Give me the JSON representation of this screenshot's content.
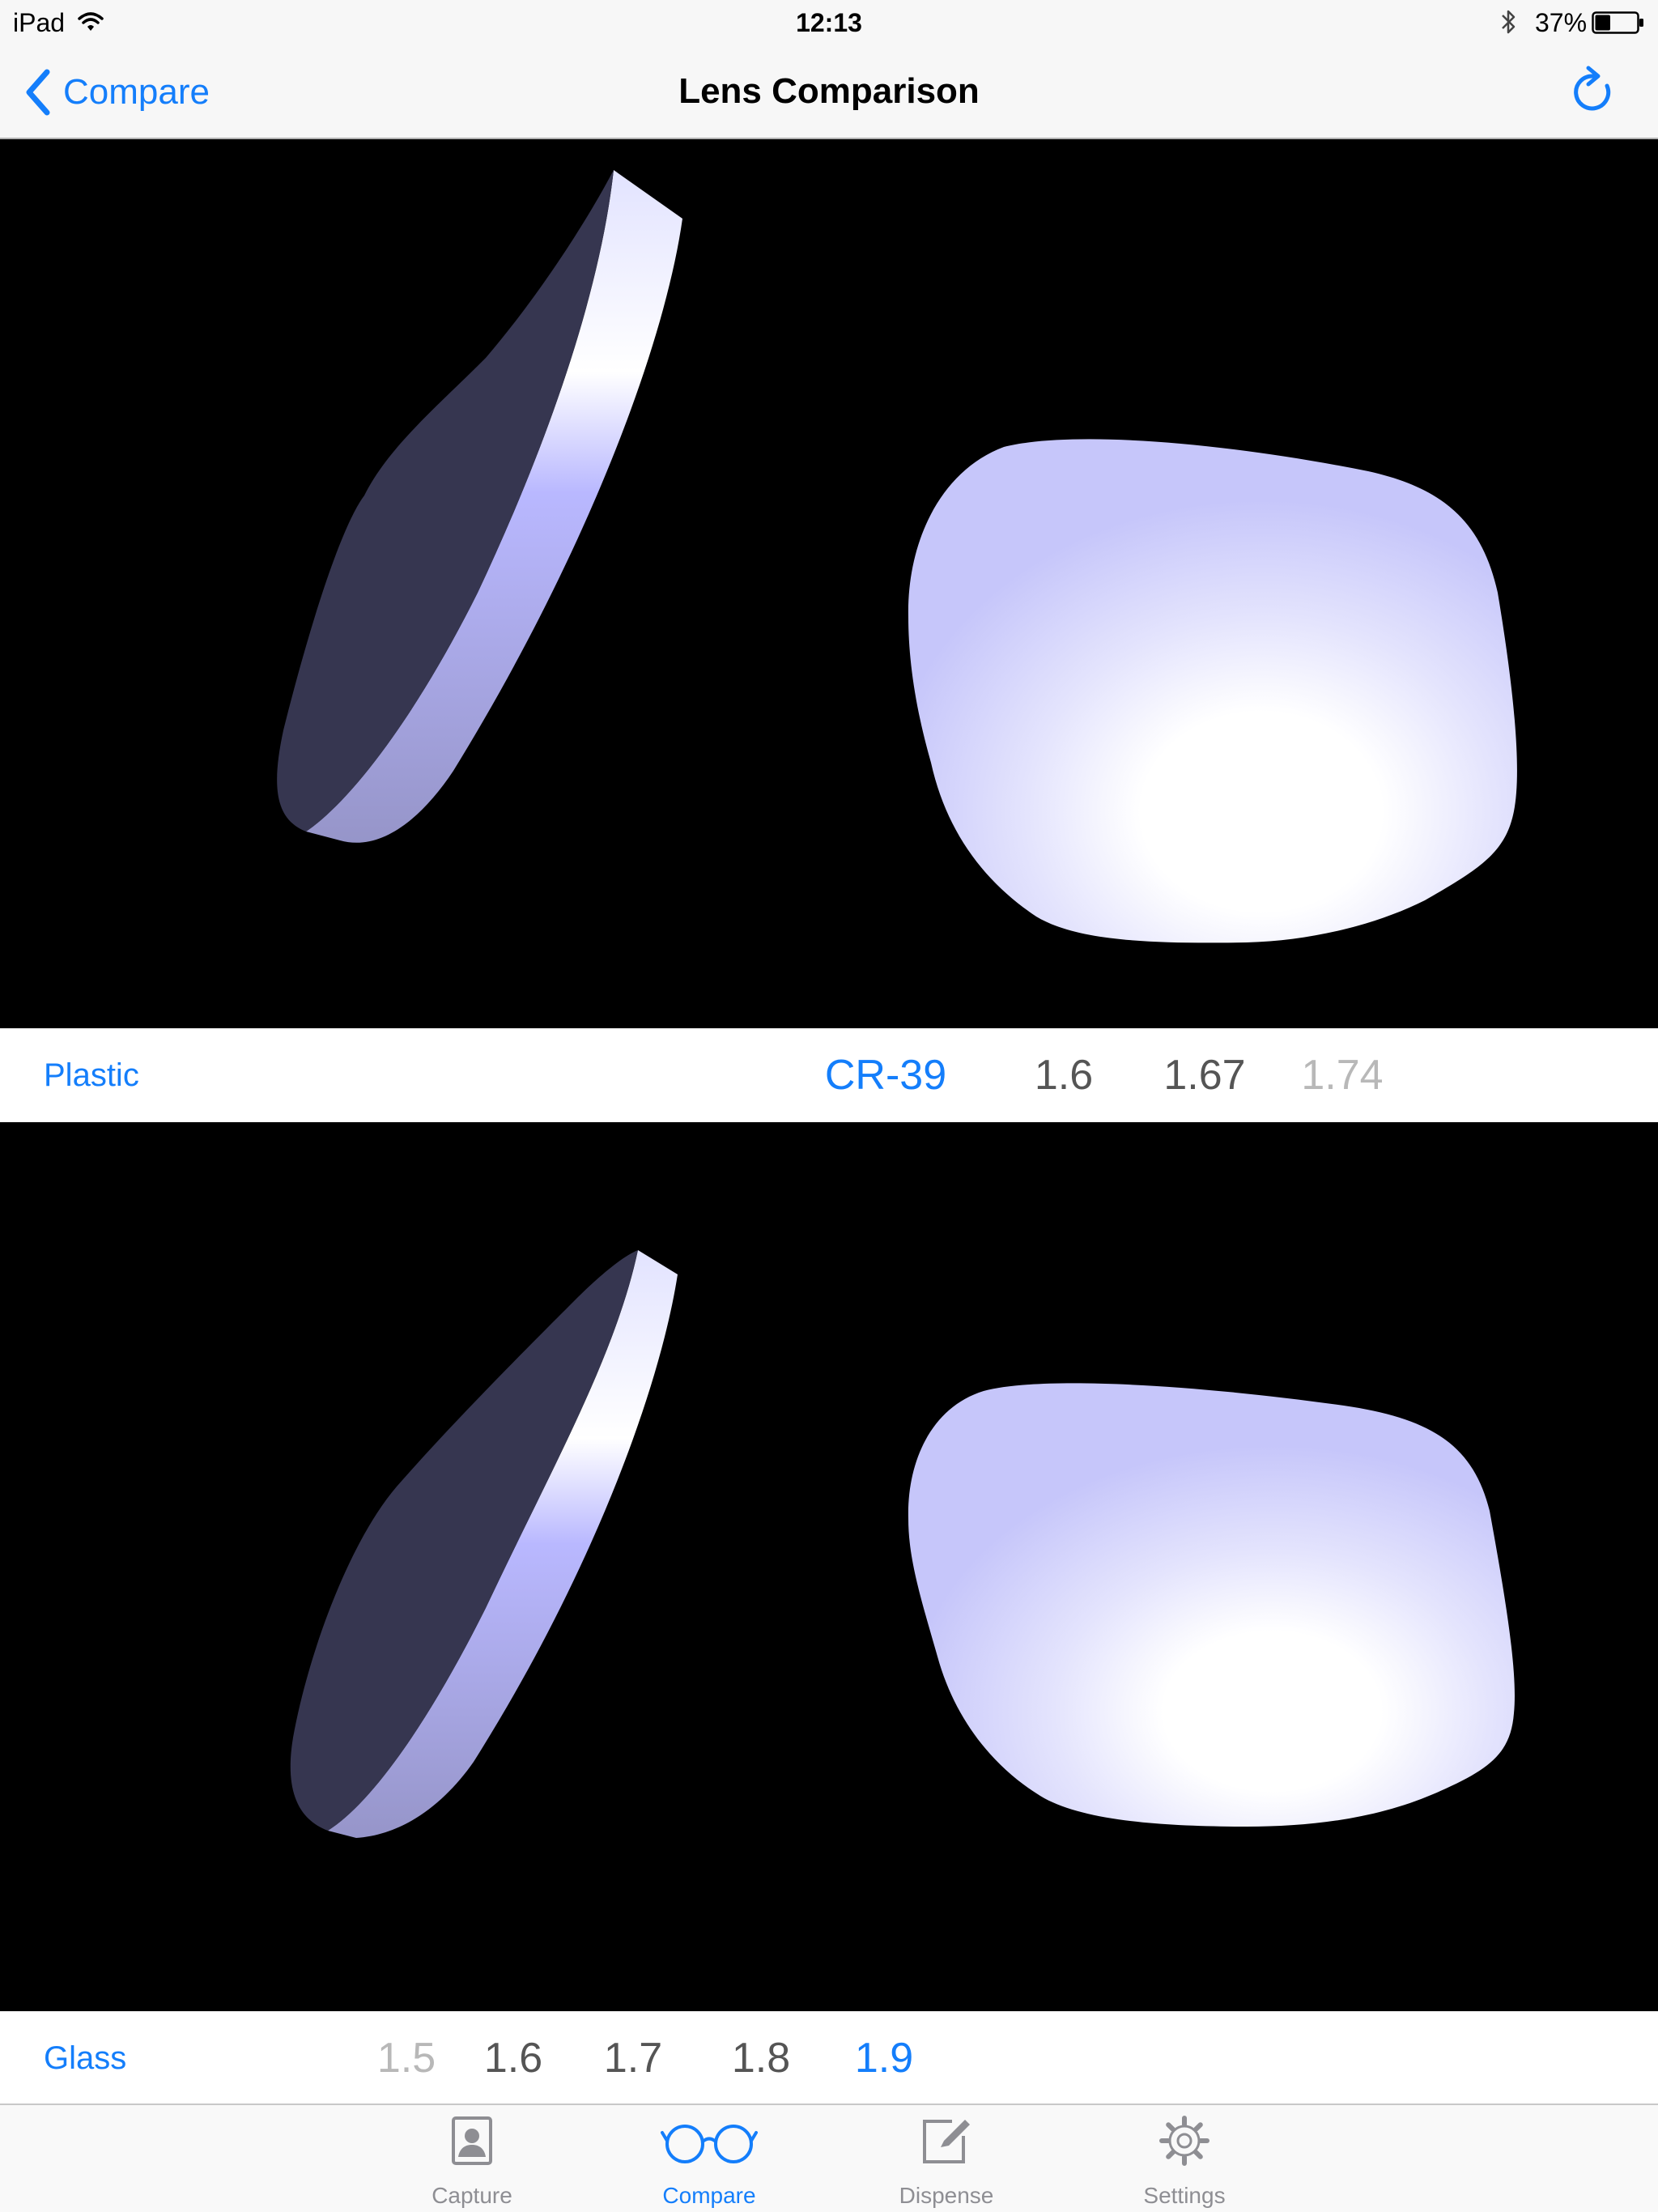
{
  "status_bar": {
    "device": "iPad",
    "time": "12:13",
    "battery": "37%",
    "battery_level": 0.37
  },
  "nav": {
    "back_label": "Compare",
    "title": "Lens Comparison"
  },
  "plastic": {
    "label": "Plastic",
    "options": [
      "CR-39",
      "1.6",
      "1.67",
      "1.74"
    ],
    "selected": "CR-39"
  },
  "glass": {
    "label": "Glass",
    "options": [
      "1.5",
      "1.6",
      "1.7",
      "1.8",
      "1.9"
    ],
    "selected": "1.9"
  },
  "tabs": [
    {
      "label": "Capture",
      "icon": "contact-card-icon"
    },
    {
      "label": "Compare",
      "icon": "glasses-icon"
    },
    {
      "label": "Dispense",
      "icon": "edit-pencil-icon"
    },
    {
      "label": "Settings",
      "icon": "gear-icon"
    }
  ],
  "active_tab": "Compare",
  "colors": {
    "accent": "#147efb",
    "viewport_background": "#000000",
    "lens_face": "#dadbff",
    "lens_edge_dark": "#363650"
  }
}
